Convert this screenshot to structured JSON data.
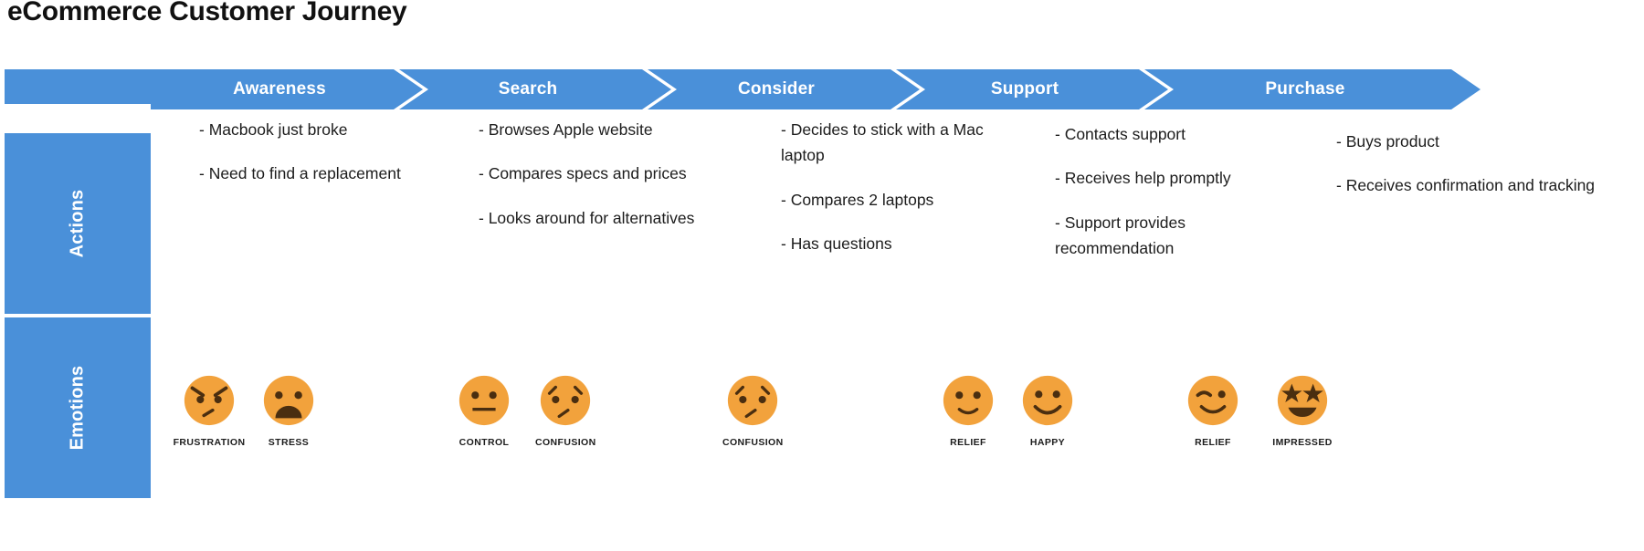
{
  "title": "eCommerce Customer Journey",
  "colors": {
    "stage_blue": "#4a90d9",
    "emoji_orange": "#f2a23c",
    "emoji_feature": "#4a2e10",
    "text": "#1c1c1c"
  },
  "sidebar": {
    "header_label": "",
    "rows": [
      {
        "label": "Actions"
      },
      {
        "label": "Emotions"
      }
    ]
  },
  "stages": [
    {
      "label": "Awareness"
    },
    {
      "label": "Search"
    },
    {
      "label": "Consider"
    },
    {
      "label": "Support"
    },
    {
      "label": "Purchase"
    }
  ],
  "actions": [
    {
      "stage": "Awareness",
      "items": [
        "- Macbook just broke",
        "- Need to find a replacement"
      ]
    },
    {
      "stage": "Search",
      "items": [
        "- Browses Apple website",
        "- Compares specs and prices",
        "- Looks around for alternatives"
      ]
    },
    {
      "stage": "Consider",
      "items": [
        "- Decides to stick with a Mac laptop",
        "- Compares 2 laptops",
        "- Has questions"
      ]
    },
    {
      "stage": "Support",
      "items": [
        "- Contacts support",
        "- Receives help promptly",
        "- Support provides recommendation"
      ]
    },
    {
      "stage": "Purchase",
      "items": [
        "- Buys product",
        "- Receives confirmation and tracking"
      ]
    }
  ],
  "emotions": [
    {
      "stage": "Awareness",
      "label": "FRUSTRATION",
      "icon": "angry-face-icon"
    },
    {
      "stage": "Awareness",
      "label": "STRESS",
      "icon": "stressed-face-icon"
    },
    {
      "stage": "Search",
      "label": "CONTROL",
      "icon": "neutral-face-icon"
    },
    {
      "stage": "Search",
      "label": "CONFUSION",
      "icon": "confused-face-icon"
    },
    {
      "stage": "Consider",
      "label": "CONFUSION",
      "icon": "confused-face-icon"
    },
    {
      "stage": "Support",
      "label": "RELIEF",
      "icon": "slight-smile-face-icon"
    },
    {
      "stage": "Support",
      "label": "HAPPY",
      "icon": "happy-face-icon"
    },
    {
      "stage": "Purchase",
      "label": "RELIEF",
      "icon": "winking-face-icon"
    },
    {
      "stage": "Purchase",
      "label": "IMPRESSED",
      "icon": "star-struck-face-icon"
    }
  ]
}
